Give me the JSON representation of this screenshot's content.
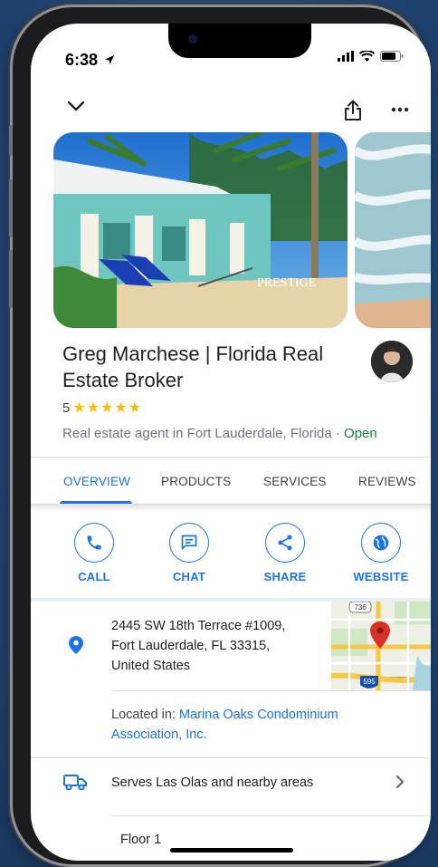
{
  "status": {
    "time": "6:38"
  },
  "place": {
    "name": "Greg Marchese | Florida Real Estate Broker",
    "rating": "5",
    "stars": "★★★★★",
    "category": "Real estate agent in Fort Lauderdale, Florida",
    "separator": " · ",
    "open_status": "Open",
    "hero_watermark": "PRESTIGE"
  },
  "tabs": [
    "OVERVIEW",
    "PRODUCTS",
    "SERVICES",
    "REVIEWS"
  ],
  "actions": [
    "CALL",
    "CHAT",
    "SHARE",
    "WEBSITE"
  ],
  "address": {
    "line1": "2445 SW 18th Terrace #1009,",
    "line2": "Fort Lauderdale, FL 33315,",
    "line3": "United States"
  },
  "map": {
    "shield_top": "736",
    "shield_bottom": "595"
  },
  "located": {
    "prefix": "Located in: ",
    "link": "Marina Oaks Condominium Association, Inc."
  },
  "serves": "Serves Las Olas and nearby areas",
  "floor": "Floor 1",
  "colors": {
    "accent": "#1a73e8",
    "open": "#188038",
    "star": "#fbbc04",
    "pin": "#1a73e8"
  }
}
